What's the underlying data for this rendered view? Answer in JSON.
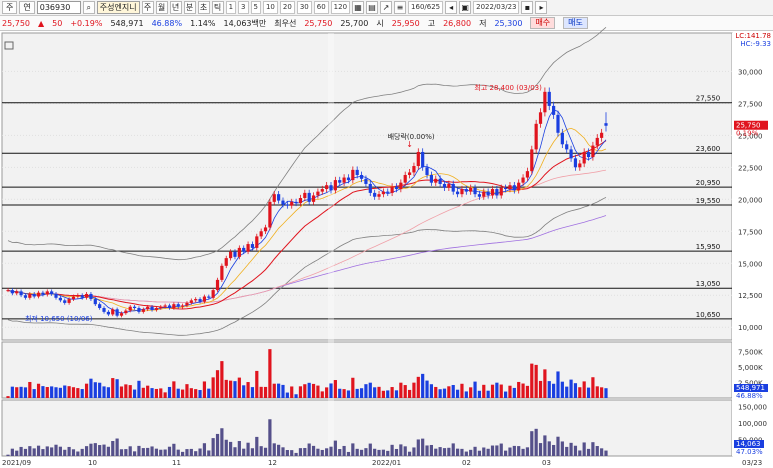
{
  "toolbar": {
    "menu_label": "주",
    "code_label": "연",
    "stock_code": "036930",
    "stock_name": "주성엔지니",
    "period_buttons": [
      "주",
      "월",
      "년",
      "분",
      "초",
      "틱"
    ],
    "interval_buttons": [
      "1",
      "3",
      "5",
      "10",
      "20",
      "30",
      "60",
      "120"
    ],
    "count": "160/625",
    "date": "2022/03/23"
  },
  "quote": {
    "price": "25,750",
    "change": "50",
    "change_pct": "+0.19%",
    "volume": "548,971",
    "volume_ratio": "46.88%",
    "turnover_pct": "1.14%",
    "amount": "14,063백만",
    "best_label": "최우선",
    "best_price": "25,750",
    "best_price2": "25,700",
    "open_label": "시",
    "open": "25,950",
    "high_label": "고",
    "high": "26,800",
    "low_label": "저",
    "low": "25,300",
    "buy_label": "매수",
    "sell_label": "매도"
  },
  "price_axis": [
    "30,000",
    "27,500",
    "25,000",
    "22,500",
    "20,000",
    "17,500",
    "15,000",
    "12,500",
    "10,000"
  ],
  "levels": [
    "27,550",
    "23,600",
    "20,950",
    "19,550",
    "15,950",
    "13,050",
    "10,650"
  ],
  "current_price_tag": "25,750",
  "current_pct_tag": "0.19%",
  "top_right_labels": [
    "LC:141.78",
    "HC:-9.33"
  ],
  "annotations": {
    "high": "최고 28,400 (03/03)",
    "low": "최저 10,650 (10/06)",
    "dividend": "배당락(0.00%)"
  },
  "volume_axis": [
    "7,500K",
    "5,000K",
    "2,500K"
  ],
  "volume_tags": [
    "548,971",
    "46.88%"
  ],
  "amount_axis": [
    "150,000",
    "100,000",
    "50,000"
  ],
  "amount_tags": [
    "14,063",
    "47.03%"
  ],
  "x_labels": [
    "2021/09",
    "10",
    "11",
    "12",
    "2022/01",
    "02",
    "03",
    "03/23"
  ],
  "colors": {
    "up": "#e0141e",
    "down": "#1a3fe0",
    "bg": "#ffffff",
    "grid": "#d9d9d9",
    "band": "#808080"
  },
  "chart_data": {
    "type": "candlestick",
    "x_range": [
      "2021/09",
      "2022/03/23"
    ],
    "ylim": [
      9000,
      33000
    ],
    "last": {
      "open": 25950,
      "high": 26800,
      "low": 25300,
      "close": 25750
    },
    "period_high": {
      "value": 28400,
      "date": "03/03"
    },
    "period_low": {
      "value": 10650,
      "date": "10/06"
    },
    "closes": [
      12900,
      12650,
      12800,
      12500,
      12300,
      12600,
      12400,
      12700,
      12550,
      12800,
      12600,
      12300,
      12100,
      11900,
      12200,
      12400,
      12500,
      12300,
      12600,
      12200,
      11800,
      11500,
      11200,
      11000,
      11400,
      10900,
      11100,
      11300,
      11600,
      11500,
      11200,
      11400,
      11600,
      11350,
      11500,
      11600,
      11700,
      11500,
      11800,
      11600,
      11700,
      11900,
      12100,
      12200,
      12000,
      12400,
      12300,
      12900,
      13700,
      14800,
      15400,
      15900,
      15500,
      16200,
      15900,
      16500,
      16200,
      17100,
      17500,
      17800,
      19800,
      20400,
      19900,
      19600,
      19500,
      19800,
      19700,
      20100,
      20500,
      19800,
      20300,
      20600,
      20800,
      21100,
      20700,
      21500,
      21300,
      21700,
      21500,
      22300,
      21900,
      21600,
      21200,
      20500,
      20200,
      20400,
      20600,
      20500,
      21000,
      20800,
      21300,
      21900,
      22100,
      22600,
      23700,
      22500,
      21900,
      21300,
      21600,
      21200,
      20900,
      21200,
      20600,
      20400,
      20800,
      20600,
      20900,
      20400,
      20200,
      20600,
      20300,
      20800,
      20300,
      20900,
      20800,
      21100,
      20700,
      21300,
      21700,
      22200,
      23900,
      25900,
      26800,
      28400,
      27300,
      26600,
      25200,
      24300,
      23900,
      23200,
      22500,
      22800,
      23700,
      23300,
      24200,
      24800,
      25200,
      25750
    ],
    "volume_series": {
      "axis_max_k": 9000
    },
    "amount_series": {
      "axis_max": 170000
    }
  }
}
